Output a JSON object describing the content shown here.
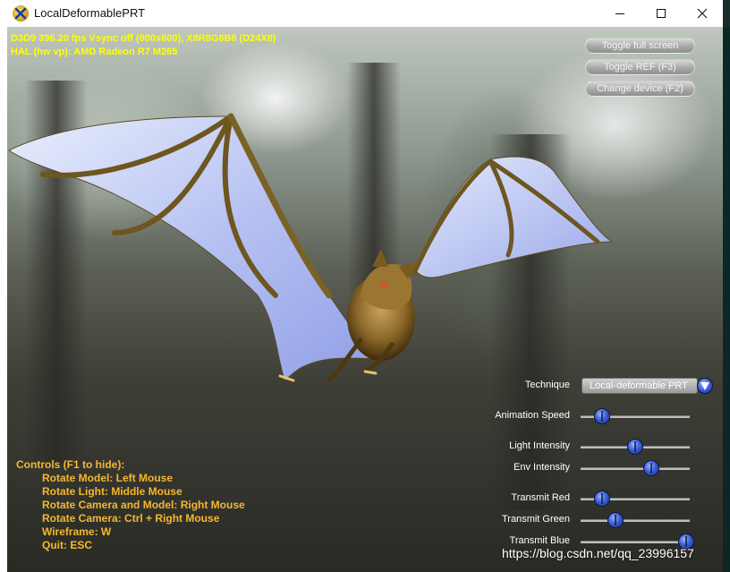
{
  "window": {
    "title": "LocalDeformablePRT",
    "buttons": {
      "minimize": "minimize-icon",
      "maximize": "maximize-icon",
      "close": "close-icon"
    }
  },
  "stats": {
    "line1": "D3D9 396.20 fps Vsync off (800x600), X8R8G8B8 (D24X8)",
    "line2": "HAL (hw vp): AMD Radeon R7 M265"
  },
  "hud_buttons": [
    {
      "label": "Toggle full screen"
    },
    {
      "label": "Toggle REF (F3)"
    },
    {
      "label": "Change device (F2)"
    }
  ],
  "technique": {
    "label": "Technique",
    "selected": "Local-deformable PRT"
  },
  "sliders": [
    {
      "label": "Animation Speed",
      "value": 0.2
    },
    {
      "label": "Light Intensity",
      "value": 0.5
    },
    {
      "label": "Env Intensity",
      "value": 0.65
    },
    {
      "label": "Transmit Red",
      "value": 0.2
    },
    {
      "label": "Transmit Green",
      "value": 0.32
    },
    {
      "label": "Transmit Blue",
      "value": 0.97
    }
  ],
  "controls": {
    "title": "Controls (F1 to hide):",
    "items": [
      "Rotate Model: Left Mouse",
      "Rotate Light: Middle Mouse",
      "Rotate Camera and Model: Right Mouse",
      "Rotate Camera: Ctrl + Right Mouse",
      "Wireframe: W",
      "Quit: ESC"
    ]
  },
  "watermark": "https://blog.csdn.net/qq_23996157",
  "colors": {
    "stats": "#ffff00",
    "controls": "#f5b82e",
    "slider_thumb": "#3c5fd8"
  }
}
